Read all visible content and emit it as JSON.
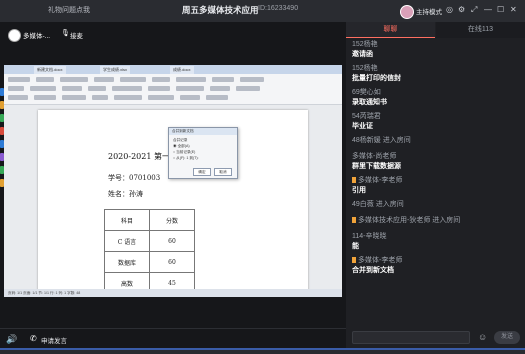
{
  "titlebar": {
    "tab_label": "礼物问题点我",
    "title": "周五多媒体技术应用",
    "room_id": "ID:16233490",
    "mode_label": "主持模式",
    "icons": [
      "target-icon",
      "settings-icon",
      "share-icon",
      "minimize-icon",
      "maximize-icon",
      "close-icon"
    ]
  },
  "stage": {
    "teacher_name": "多媒体-...",
    "mic_label": "接麦"
  },
  "shared_document": {
    "tabs": [
      "新建文档.docx",
      "学生成绩.xlsx",
      "成绩.docx"
    ],
    "title": "2020-2021 第一学期",
    "student_id": "学号：0701003",
    "student_name": "姓名：孙涛",
    "table": {
      "headers": [
        "科目",
        "分数"
      ],
      "rows": [
        [
          "C 语言",
          "60"
        ],
        [
          "数据库",
          "60"
        ],
        [
          "高数",
          "45"
        ]
      ]
    },
    "dialog": {
      "title": "合并到新文档",
      "lines": [
        "合并记录",
        "◉ 全部(A)",
        "○ 当前记录(E)",
        "○ 从(F): 1  到(T):"
      ],
      "ok": "确定",
      "cancel": "取消"
    },
    "status": "页码: 1/1  页面: 1/1  节: 1/1  行: 1  列: 1  字数: 48"
  },
  "bottombar": {
    "apply_label": "申请发言"
  },
  "sidebar": {
    "tabs": [
      "聊聊",
      "在线113"
    ],
    "messages": [
      {
        "type": "msg",
        "name": "152杨艳",
        "text": "邀请函"
      },
      {
        "type": "msg",
        "name": "152杨艳",
        "text": "批量打印的信封"
      },
      {
        "type": "msg",
        "name": "69樊心如",
        "text": "录取通知书"
      },
      {
        "type": "msg",
        "name": "54芮瑞君",
        "text": "毕业证"
      },
      {
        "type": "join",
        "text": "48杨新媛 进入房间"
      },
      {
        "type": "msg",
        "name": "多媒体-尚老师",
        "text": "群里下载数据源"
      },
      {
        "type": "msg",
        "name": "多媒体-李老师",
        "text": "引用",
        "badge": true
      },
      {
        "type": "join",
        "text": "49白薇 进入房间"
      },
      {
        "type": "join",
        "text": "多媒体技术应用-狄老师 进入房间",
        "badge": true
      },
      {
        "type": "msg",
        "name": "114-辛晓晓",
        "text": "能"
      },
      {
        "type": "msg",
        "name": "多媒体-李老师",
        "text": "合并到新文档",
        "badge": true
      }
    ],
    "input_placeholder": "",
    "send_label": "发送"
  },
  "colors": {
    "accent": "#ff6f61",
    "background": "#1b1c20",
    "badge": "#f0a33a"
  }
}
